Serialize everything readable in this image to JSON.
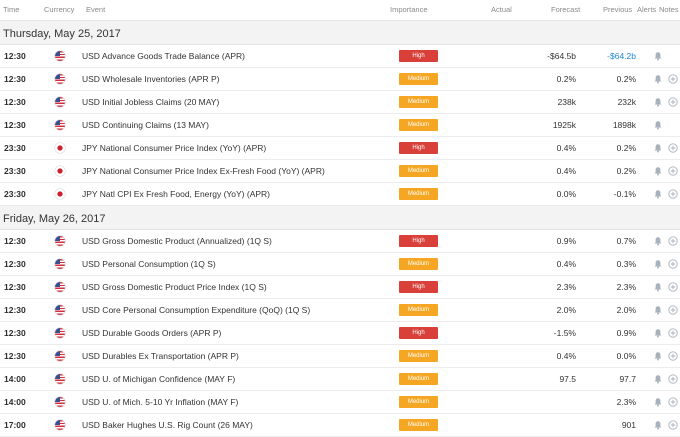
{
  "header": {
    "time": "Time",
    "currency": "Currency",
    "event": "Event",
    "importance": "Importance",
    "actual": "Actual",
    "forecast": "Forecast",
    "previous": "Previous",
    "alerts": "Alerts",
    "notes": "Notes"
  },
  "colors": {
    "high": "#d9403a",
    "medium": "#f5a623",
    "previous_better": "#1d8ad6"
  },
  "icons": {
    "alert": "bell-icon",
    "note": "plus-circle-icon"
  },
  "days": [
    {
      "date": "Thursday, May 25, 2017",
      "events": [
        {
          "time": "12:30",
          "currency": "us-flag",
          "event": "USD Advance Goods Trade Balance (APR)",
          "importance": "High",
          "actual": "",
          "forecast": "-$64.5b",
          "previous": "-$64.2b",
          "previous_better": true,
          "note": false
        },
        {
          "time": "12:30",
          "currency": "us-flag",
          "event": "USD Wholesale Inventories (APR P)",
          "importance": "Medium",
          "actual": "",
          "forecast": "0.2%",
          "previous": "0.2%",
          "previous_better": false,
          "note": true
        },
        {
          "time": "12:30",
          "currency": "us-flag",
          "event": "USD Initial Jobless Claims (20 MAY)",
          "importance": "Medium",
          "actual": "",
          "forecast": "238k",
          "previous": "232k",
          "previous_better": false,
          "note": true
        },
        {
          "time": "12:30",
          "currency": "us-flag",
          "event": "USD Continuing Claims (13 MAY)",
          "importance": "Medium",
          "actual": "",
          "forecast": "1925k",
          "previous": "1898k",
          "previous_better": false,
          "note": false
        },
        {
          "time": "23:30",
          "currency": "jp-flag",
          "event": "JPY National Consumer Price Index (YoY) (APR)",
          "importance": "High",
          "actual": "",
          "forecast": "0.4%",
          "previous": "0.2%",
          "previous_better": false,
          "note": true
        },
        {
          "time": "23:30",
          "currency": "jp-flag",
          "event": "JPY National Consumer Price Index Ex-Fresh Food (YoY) (APR)",
          "importance": "Medium",
          "actual": "",
          "forecast": "0.4%",
          "previous": "0.2%",
          "previous_better": false,
          "note": true
        },
        {
          "time": "23:30",
          "currency": "jp-flag",
          "event": "JPY Natl CPI Ex Fresh Food, Energy (YoY) (APR)",
          "importance": "Medium",
          "actual": "",
          "forecast": "0.0%",
          "previous": "-0.1%",
          "previous_better": false,
          "note": true
        }
      ]
    },
    {
      "date": "Friday, May 26, 2017",
      "events": [
        {
          "time": "12:30",
          "currency": "us-flag",
          "event": "USD Gross Domestic Product (Annualized) (1Q S)",
          "importance": "High",
          "actual": "",
          "forecast": "0.9%",
          "previous": "0.7%",
          "previous_better": false,
          "note": true
        },
        {
          "time": "12:30",
          "currency": "us-flag",
          "event": "USD Personal Consumption (1Q S)",
          "importance": "Medium",
          "actual": "",
          "forecast": "0.4%",
          "previous": "0.3%",
          "previous_better": false,
          "note": true
        },
        {
          "time": "12:30",
          "currency": "us-flag",
          "event": "USD Gross Domestic Product Price Index (1Q S)",
          "importance": "High",
          "actual": "",
          "forecast": "2.3%",
          "previous": "2.3%",
          "previous_better": false,
          "note": true
        },
        {
          "time": "12:30",
          "currency": "us-flag",
          "event": "USD Core Personal Consumption Expenditure (QoQ) (1Q S)",
          "importance": "Medium",
          "actual": "",
          "forecast": "2.0%",
          "previous": "2.0%",
          "previous_better": false,
          "note": true
        },
        {
          "time": "12:30",
          "currency": "us-flag",
          "event": "USD Durable Goods Orders (APR P)",
          "importance": "High",
          "actual": "",
          "forecast": "-1.5%",
          "previous": "0.9%",
          "previous_better": false,
          "note": true
        },
        {
          "time": "12:30",
          "currency": "us-flag",
          "event": "USD Durables Ex Transportation (APR P)",
          "importance": "Medium",
          "actual": "",
          "forecast": "0.4%",
          "previous": "0.0%",
          "previous_better": false,
          "note": true
        },
        {
          "time": "14:00",
          "currency": "us-flag",
          "event": "USD U. of Michigan Confidence (MAY F)",
          "importance": "Medium",
          "actual": "",
          "forecast": "97.5",
          "previous": "97.7",
          "previous_better": false,
          "note": true
        },
        {
          "time": "14:00",
          "currency": "us-flag",
          "event": "USD U. of Mich. 5-10 Yr Inflation (MAY F)",
          "importance": "Medium",
          "actual": "",
          "forecast": "",
          "previous": "2.3%",
          "previous_better": false,
          "note": true
        },
        {
          "time": "17:00",
          "currency": "us-flag",
          "event": "USD Baker Hughes U.S. Rig Count (26 MAY)",
          "importance": "Medium",
          "actual": "",
          "forecast": "",
          "previous": "901",
          "previous_better": false,
          "note": true
        }
      ]
    }
  ]
}
